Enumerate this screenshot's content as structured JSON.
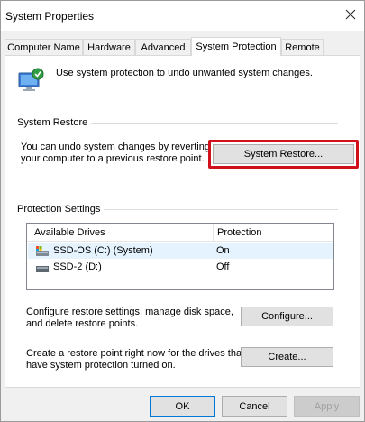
{
  "window": {
    "title": "System Properties"
  },
  "tabs": [
    {
      "label": "Computer Name"
    },
    {
      "label": "Hardware"
    },
    {
      "label": "Advanced"
    },
    {
      "label": "System Protection"
    },
    {
      "label": "Remote"
    }
  ],
  "active_tab": "System Protection",
  "intro": {
    "text": "Use system protection to undo unwanted system changes.",
    "icon": "system-protection-icon"
  },
  "system_restore": {
    "group_title": "System Restore",
    "description_line1": "You can undo system changes by reverting",
    "description_line2": "your computer to a previous restore point.",
    "button_label": "System Restore..."
  },
  "protection_settings": {
    "group_title": "Protection Settings",
    "columns": [
      "Available Drives",
      "Protection"
    ],
    "drives": [
      {
        "name": "SSD-OS (C:) (System)",
        "protection": "On",
        "icon": "system-drive-icon",
        "selected": true
      },
      {
        "name": "SSD-2 (D:)",
        "protection": "Off",
        "icon": "drive-icon",
        "selected": false
      }
    ],
    "configure_text_line1": "Configure restore settings, manage disk space,",
    "configure_text_line2": "and delete restore points.",
    "configure_button": "Configure...",
    "create_text_line1": "Create a restore point right now for the drives that",
    "create_text_line2": "have system protection turned on.",
    "create_button": "Create..."
  },
  "footer": {
    "ok": "OK",
    "cancel": "Cancel",
    "apply": "Apply"
  },
  "colors": {
    "highlight_border": "#d0101b",
    "accent": "#0078d7"
  }
}
